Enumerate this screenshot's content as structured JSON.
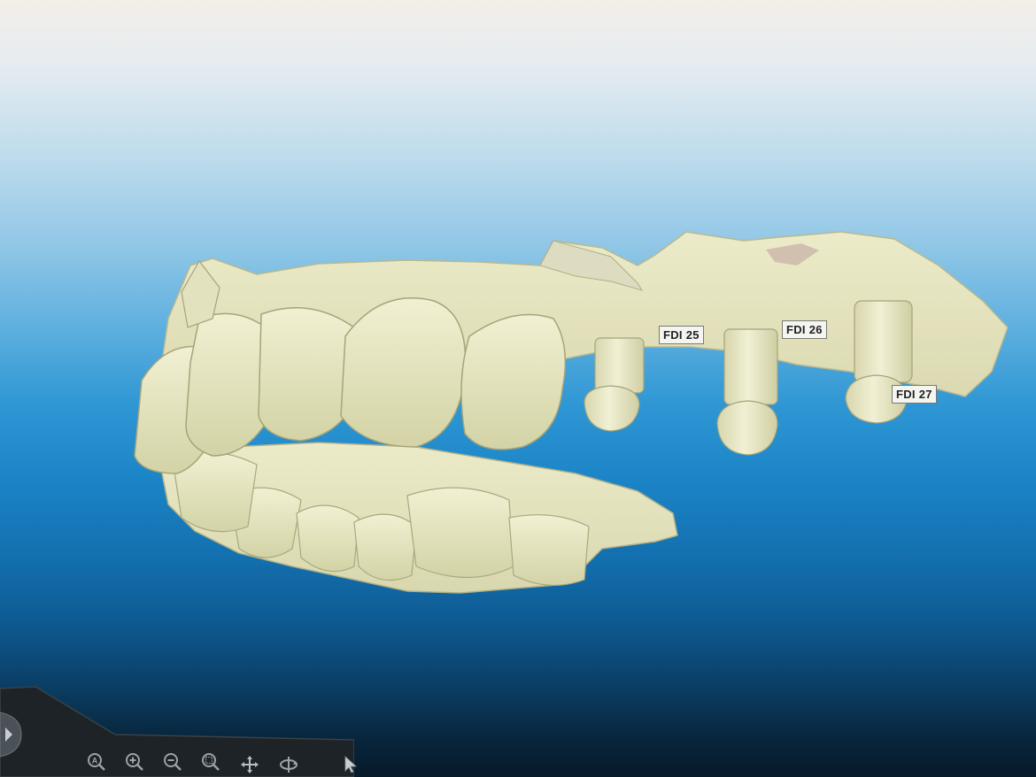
{
  "labels": {
    "fdi25": "FDI 25",
    "fdi26": "FDI 26",
    "fdi27": "FDI 27"
  },
  "toolbar": {
    "tools": [
      {
        "name": "zoom-fit-icon",
        "glyph": "A"
      },
      {
        "name": "zoom-in-icon",
        "glyph": "+"
      },
      {
        "name": "zoom-out-icon",
        "glyph": "−"
      },
      {
        "name": "zoom-window-icon",
        "glyph": "◌"
      },
      {
        "name": "pan-icon",
        "glyph": "✥"
      },
      {
        "name": "rotate-icon",
        "glyph": "⟳"
      },
      {
        "name": "select-pointer-icon",
        "glyph": "➤"
      }
    ]
  },
  "colors": {
    "model": "#e9e8c4",
    "model_shade": "#cfcfa2",
    "model_dark": "#b8b88c",
    "label_bg": "#f4f4f0"
  }
}
